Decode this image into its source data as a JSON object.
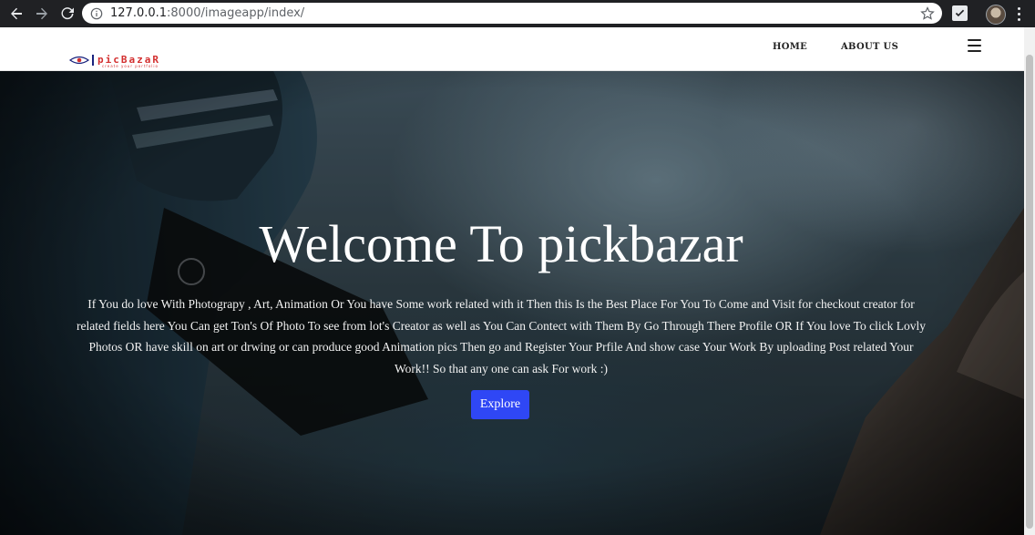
{
  "browser": {
    "url_host": "127.0.0.1",
    "url_rest": ":8000/imageapp/index/",
    "icons": [
      "back-arrow-icon",
      "forward-arrow-icon",
      "reload-icon",
      "info-icon",
      "star-icon",
      "extension-check-icon",
      "profile-avatar-icon",
      "menu-dots-icon"
    ]
  },
  "header": {
    "logo_text": "picBazaR",
    "logo_tagline": "create your portfolio",
    "nav": [
      {
        "label": "HOME"
      },
      {
        "label": "ABOUT US"
      }
    ],
    "menu_icon": "hamburger-icon"
  },
  "hero": {
    "title": "Welcome To pickbazar",
    "description": "If You do love With Photograpy , Art, Animation Or You have Some work related with it Then this Is the Best Place For You To Come and Visit for checkout creator for related fields here You Can get Ton's Of Photo To see from lot's Creator as well as You Can Contect with Them By Go Through There Profile OR If You love To click Lovly Photos OR have skill on art or drwing or can produce good Animation pics Then go and Register Your Prfile And show case Your Work By uploading Post related Your Work!! So that any one can ask For work :)",
    "button_label": "Explore"
  },
  "colors": {
    "button_bg": "#2f47f5",
    "logo_red": "#d32f2f",
    "chrome_bg": "#202124"
  }
}
